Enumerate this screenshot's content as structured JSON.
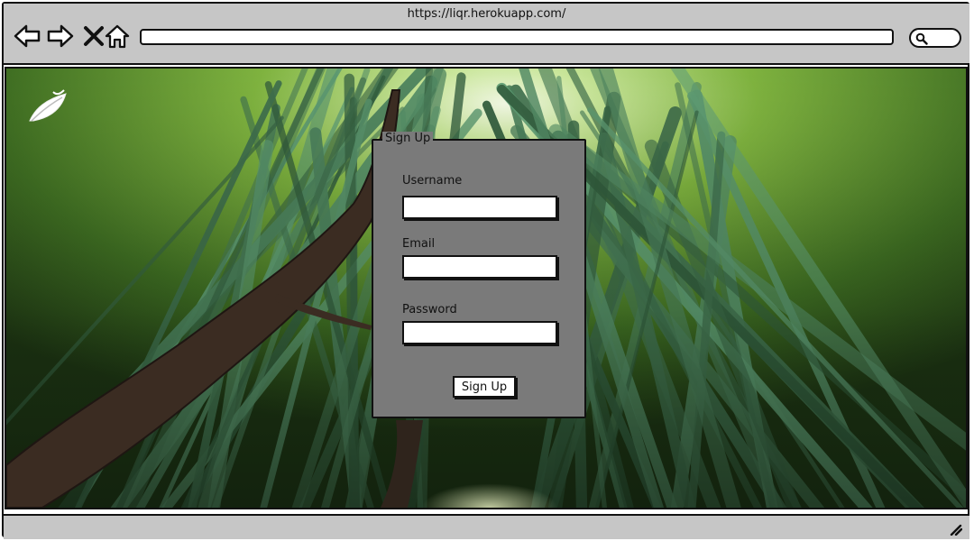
{
  "browser": {
    "url": "https://liqr.herokuapp.com/",
    "icons": [
      "back-arrow-icon",
      "forward-arrow-icon",
      "close-icon",
      "home-icon",
      "search-icon",
      "resize-grip-icon"
    ]
  },
  "page": {
    "logo_icon": "leaf-logo-icon",
    "background": "bamboo-forest-photo"
  },
  "signup_form": {
    "legend": "Sign Up",
    "username_label": "Username",
    "username_value": "",
    "email_label": "Email",
    "email_value": "",
    "password_label": "Password",
    "password_value": "",
    "submit_label": "Sign Up"
  },
  "colors": {
    "chrome": "#c6c6c6",
    "form_panel": "#7a7a7a",
    "outline": "#111111",
    "foliage": "#5f9b2e"
  }
}
